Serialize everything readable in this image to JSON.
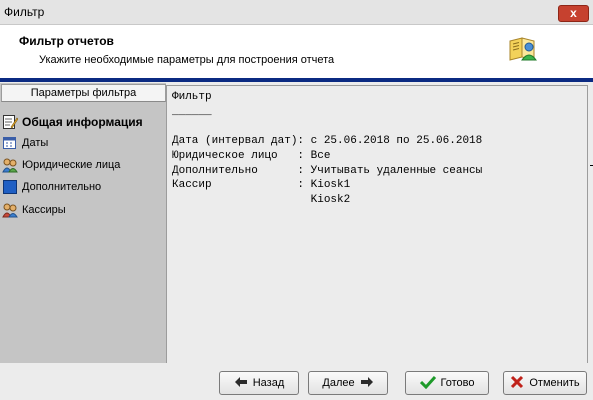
{
  "window": {
    "title": "Фильтр",
    "close_label": "x"
  },
  "header": {
    "title": "Фильтр отчетов",
    "subtitle": "Укажите необходимые параметры для построения отчета"
  },
  "sidebar": {
    "header": "Параметры фильтра",
    "items": [
      {
        "label": "Общая информация",
        "icon": "edit-document-icon",
        "active": true
      },
      {
        "label": "Даты",
        "icon": "calendar-icon",
        "active": false
      },
      {
        "label": "Юридические лица",
        "icon": "users-icon",
        "active": false
      },
      {
        "label": "Дополнительно",
        "icon": "blue-square-icon",
        "active": false
      },
      {
        "label": "Кассиры",
        "icon": "cashiers-icon",
        "active": false
      }
    ]
  },
  "summary": {
    "heading": "Фильтр",
    "underline": "______",
    "lines": [
      "Дата (интервал дат): с 25.06.2018 по 25.06.2018",
      "Юридическое лицо   : Все",
      "Дополнительно      : Учитывать удаленные сеансы",
      "Кассир             : Kiosk1",
      "                     Kiosk2"
    ]
  },
  "buttons": {
    "back": "Назад",
    "next": "Далее",
    "done": "Готово",
    "cancel": "Отменить"
  },
  "colors": {
    "accent": "#0b2a82",
    "sidebar_bg": "#c5c5c5",
    "close_red": "#c6412f",
    "done_green": "#1e9a2a",
    "cancel_red": "#c0221a"
  }
}
